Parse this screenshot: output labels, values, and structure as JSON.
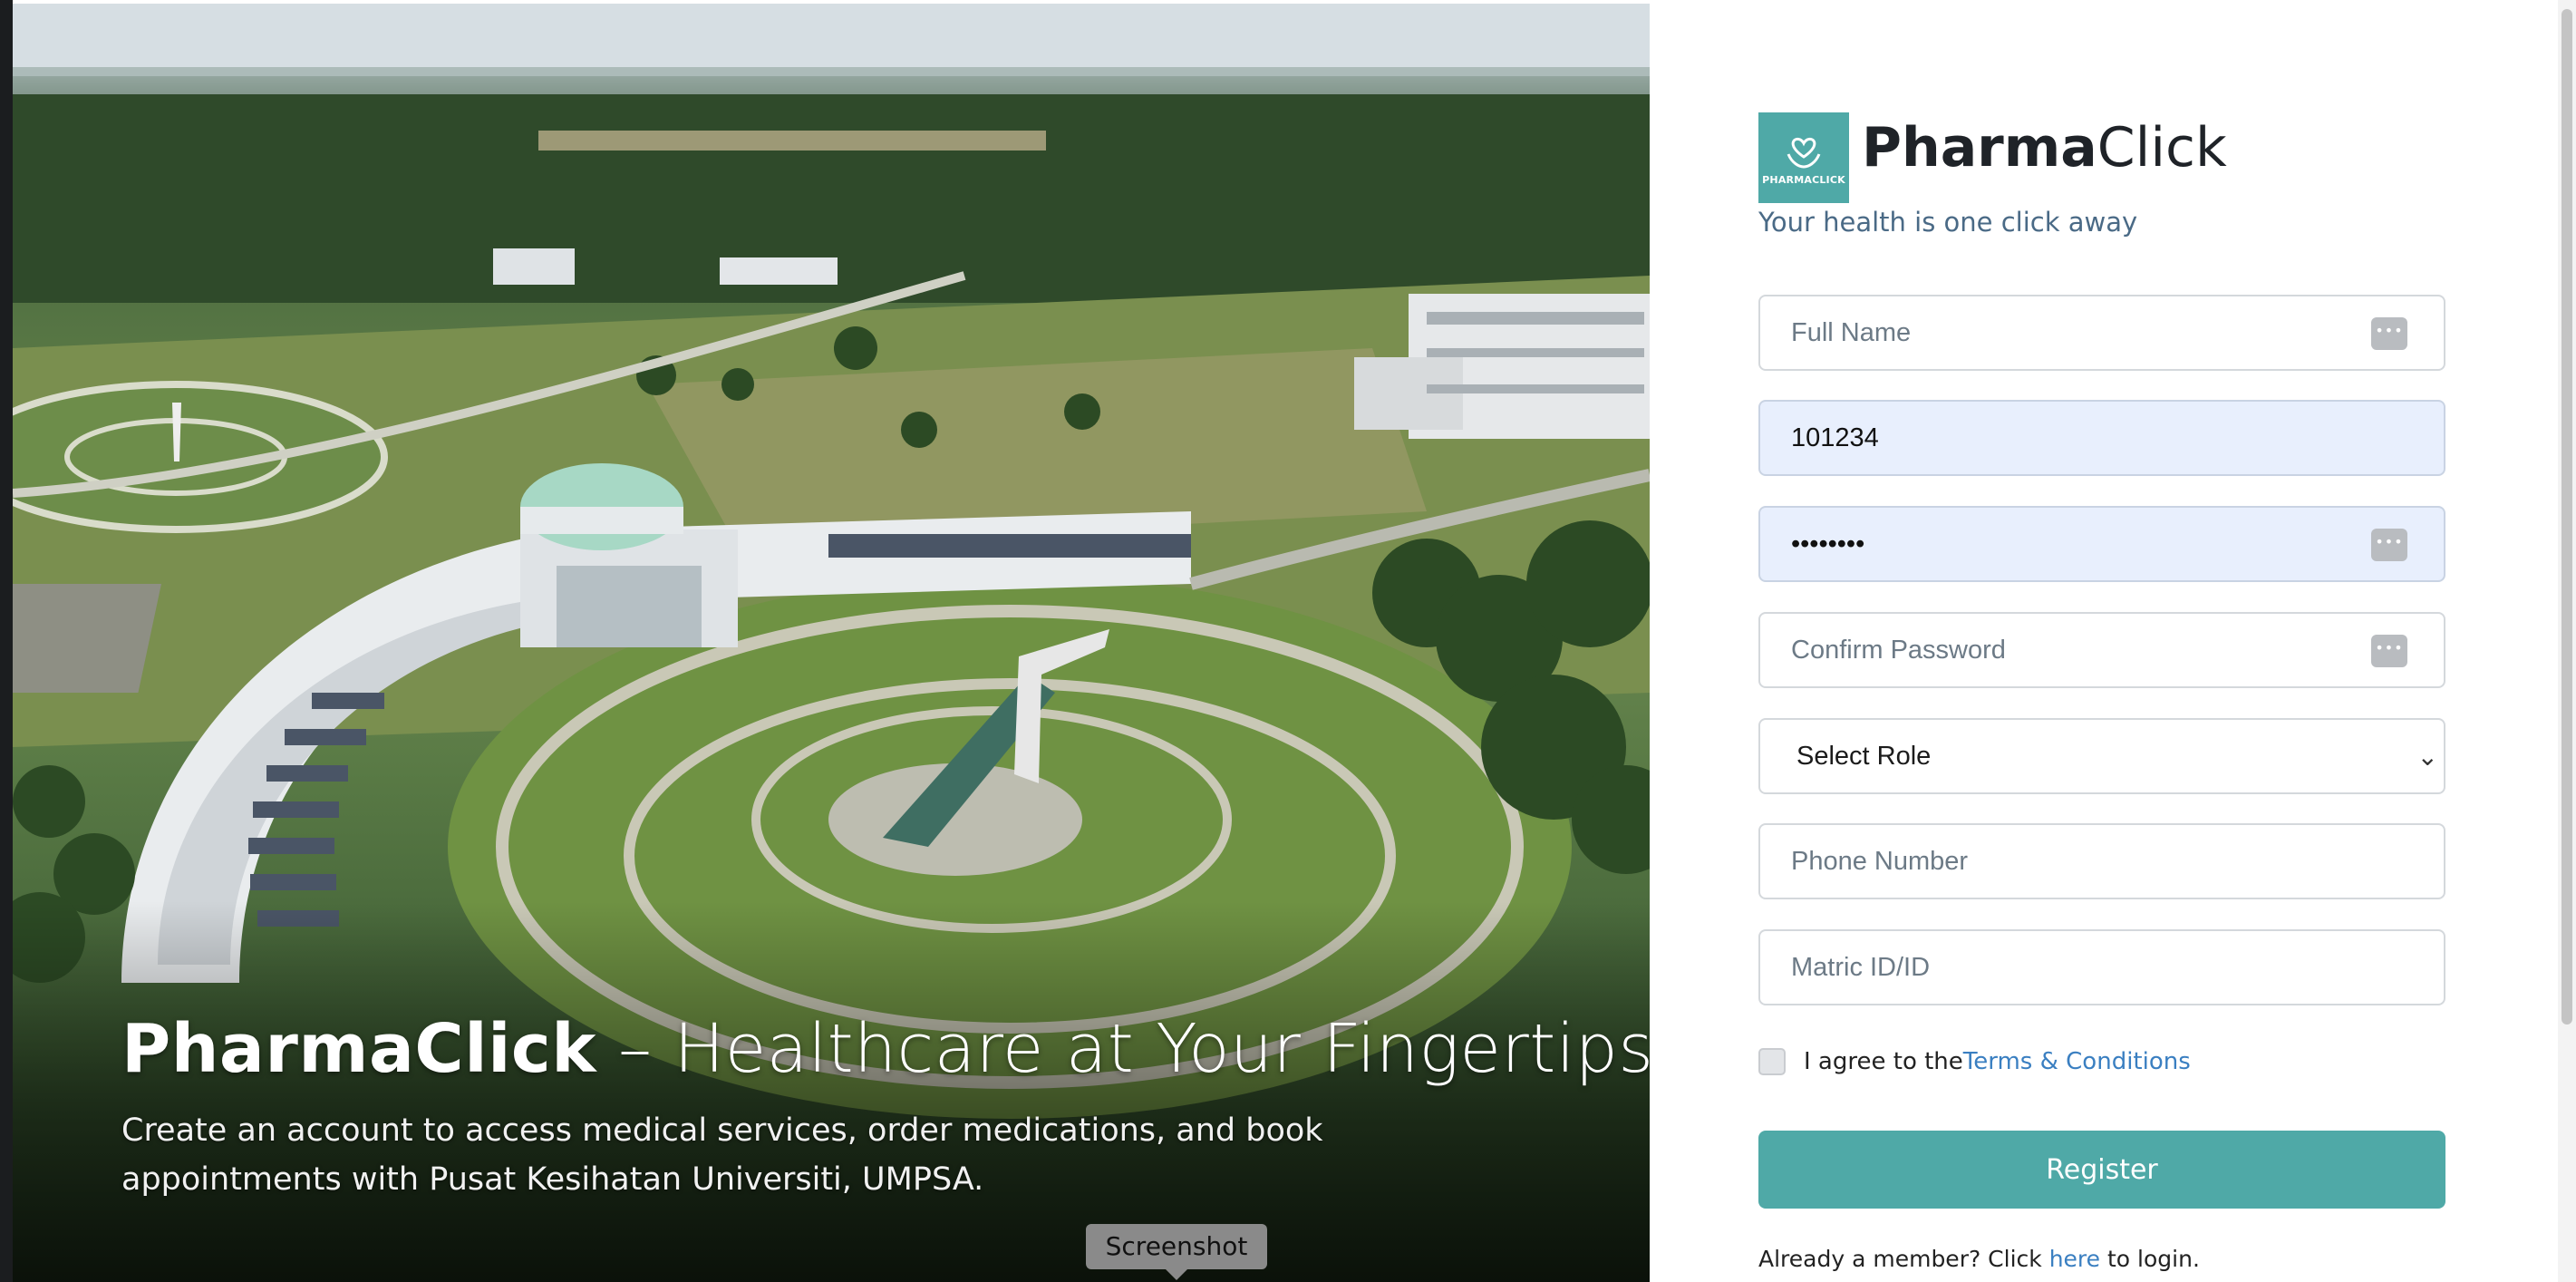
{
  "hero": {
    "title_brand": "PharmaClick",
    "title_rest": " – Healthcare at Your Fingertips",
    "subtitle": "Create an account to access medical services, order medications, and book appointments with Pusat Kesihatan Universiti, UMPSA.",
    "tooltip": "Screenshot"
  },
  "brand": {
    "logo_text": "PHARMACLICK",
    "name_bold": "Pharma",
    "name_light": "Click",
    "tagline": "Your health is one click away"
  },
  "form": {
    "full_name": {
      "placeholder": "Full Name",
      "value": ""
    },
    "username": {
      "placeholder": "",
      "value": "101234"
    },
    "password": {
      "placeholder": "",
      "value": "••••••••"
    },
    "confirm_password": {
      "placeholder": "Confirm Password",
      "value": ""
    },
    "role": {
      "selected": "Select Role"
    },
    "phone": {
      "placeholder": "Phone Number",
      "value": ""
    },
    "matric": {
      "placeholder": "Matric ID/ID",
      "value": ""
    },
    "agree_prefix": "I agree to the ",
    "terms_link": "Terms & Conditions",
    "register_label": "Register",
    "login_prefix": "Already a member? Click ",
    "login_link": "here",
    "login_suffix": " to login."
  },
  "icons": {
    "key_icon_glyph": "•••"
  },
  "colors": {
    "accent": "#4fa9a7",
    "link": "#3a7fc1",
    "autofill_bg": "#e8effd"
  }
}
